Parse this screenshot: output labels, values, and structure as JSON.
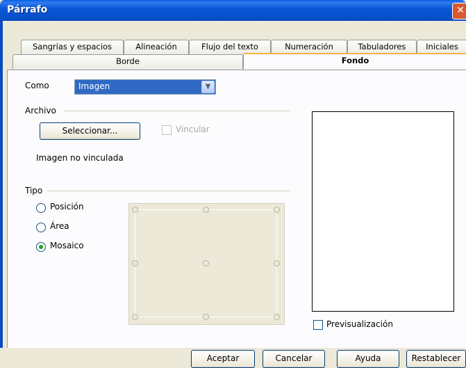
{
  "window": {
    "title": "Párrafo",
    "close_glyph": "✕"
  },
  "tabs_row1": [
    {
      "label": "Sangrías y espacios"
    },
    {
      "label": "Alineación"
    },
    {
      "label": "Flujo del texto"
    },
    {
      "label": "Numeración"
    },
    {
      "label": "Tabuladores"
    },
    {
      "label": "Iniciales"
    }
  ],
  "tabs_row2": [
    {
      "label": "Borde"
    },
    {
      "label": "Fondo",
      "active": true
    }
  ],
  "como": {
    "label": "Como",
    "value": "Imagen"
  },
  "archivo": {
    "section_label": "Archivo",
    "select_button": "Seleccionar...",
    "vincular_label": "Vincular",
    "status": "Imagen no vinculada"
  },
  "tipo": {
    "section_label": "Tipo",
    "options": [
      {
        "label": "Posición",
        "selected": false
      },
      {
        "label": "Área",
        "selected": false
      },
      {
        "label": "Mosaico",
        "selected": true
      }
    ]
  },
  "preview": {
    "label": "Previsualización"
  },
  "buttons": {
    "aceptar": "Aceptar",
    "cancelar": "Cancelar",
    "ayuda": "Ayuda",
    "restablecer": "Restablecer"
  },
  "colors": {
    "titlebar": "#0852d0",
    "selection": "#316ac5",
    "active_tab_accent": "#f6b443",
    "radio_dot": "#21a121"
  },
  "icons": [
    "close-icon",
    "chevron-down-icon"
  ]
}
